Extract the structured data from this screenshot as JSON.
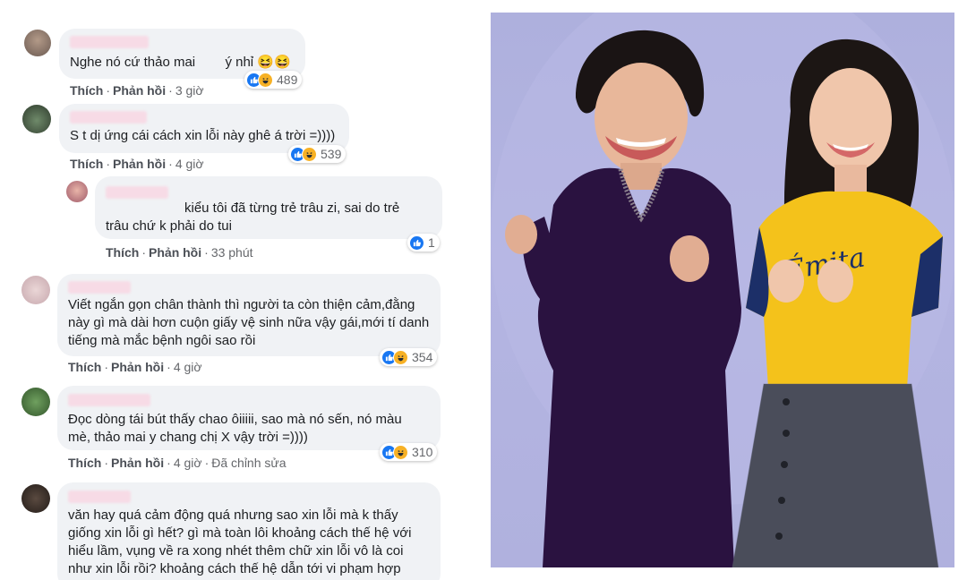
{
  "comments": [
    {
      "text": "Nghe nó cứ thảo mai        ý nhỉ 😆😆",
      "actions": [
        "Thích",
        "Phản hồi",
        "3 giờ"
      ],
      "reactions": 489
    },
    {
      "text": "S t dị ứng cái cách xin lỗi này ghê á trời =))))",
      "actions": [
        "Thích",
        "Phản hồi",
        "4 giờ"
      ],
      "reactions": 539
    },
    {
      "text": "kiểu tôi đã từng trẻ trâu zi, sai do trẻ trâu chứ k phải do tui",
      "actions": [
        "Thích",
        "Phản hồi",
        "33 phút"
      ],
      "reactions": 1
    },
    {
      "text": "Viết ngắn gọn chân thành thì người ta còn thiện cảm,đằng này gì mà dài hơn cuộn giấy vệ sinh nữa vậy gái,mới tí danh tiếng mà mắc bệnh ngôi sao rồi",
      "actions": [
        "Thích",
        "Phản hồi",
        "4 giờ"
      ],
      "reactions": 354
    },
    {
      "text": "Đọc dòng tái bút thấy chao ôiiiii, sao mà nó sến, nó màu mè, thảo mai y chang chị X vậy trời =))))",
      "actions": [
        "Thích",
        "Phản hồi",
        "4 giờ",
        "Đã chỉnh sửa"
      ],
      "reactions": 310
    },
    {
      "text": "văn hay quá cảm động quá nhưng sao xin lỗi mà k thấy giống xin lỗi gì hết? gì mà toàn lôi khoảng cách thế hệ với hiểu lầm, vụng về ra xong nhét thêm chữ xin lỗi vô là coi như xin lỗi rồi? khoảng cách thế hệ dẫn tới vi phạm hợp"
    }
  ],
  "colors": {
    "bubble": "#f0f2f5",
    "like": "#1877f2",
    "haha": "#f7b125",
    "photo_bg": "#b0b1de",
    "dress": "#2a1240",
    "shirt": "#f4c21b",
    "skirt": "#4a4d5a"
  },
  "icons": [
    "like-reaction-icon",
    "haha-reaction-icon"
  ]
}
